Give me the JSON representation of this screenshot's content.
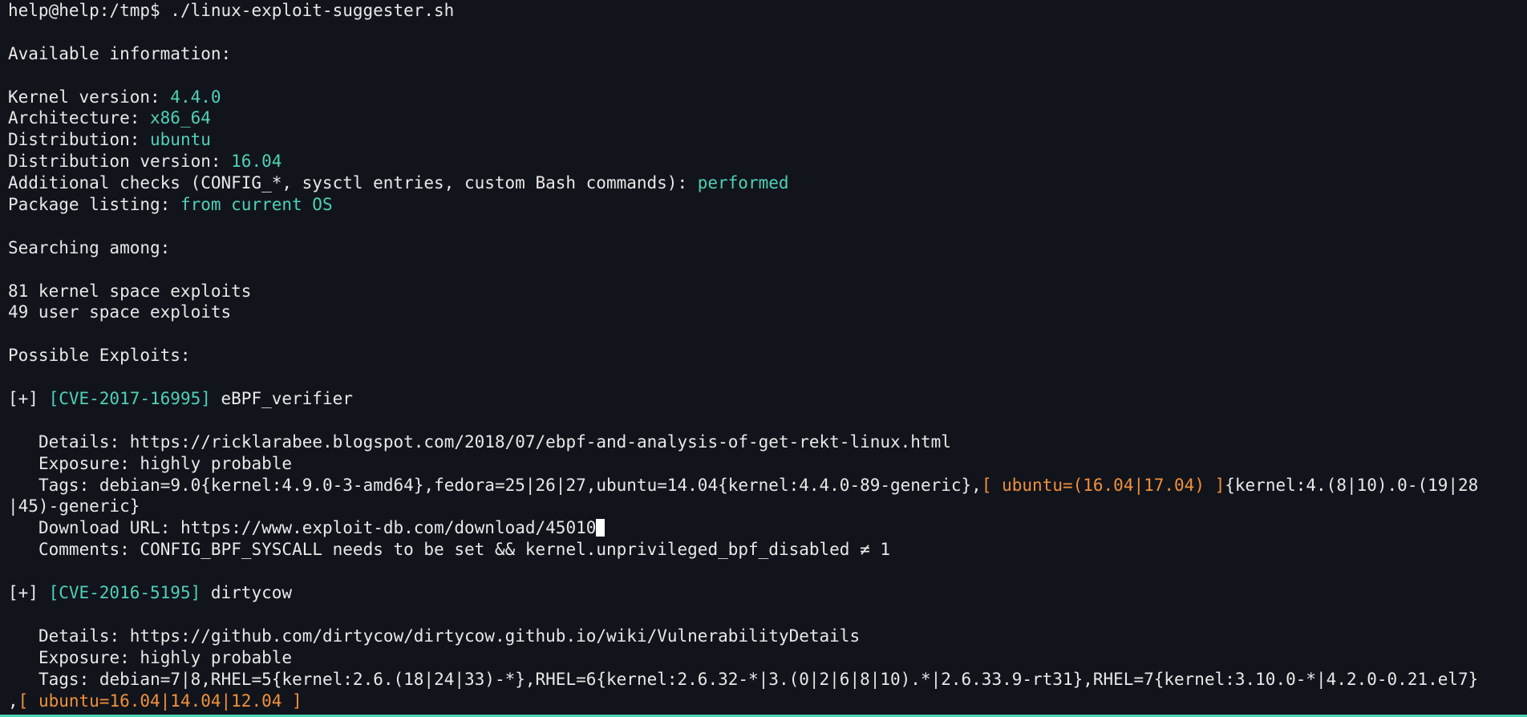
{
  "prompt": {
    "user_host": "help@help:/tmp$",
    "command": " ./linux-exploit-suggester.sh"
  },
  "available": {
    "heading": "Available information:",
    "kernel_label": "Kernel version: ",
    "kernel_value": "4.4.0",
    "arch_label": "Architecture: ",
    "arch_value": "x86_64",
    "dist_label": "Distribution: ",
    "dist_value": "ubuntu",
    "distver_label": "Distribution version: ",
    "distver_value": "16.04",
    "checks_label": "Additional checks (CONFIG_*, sysctl entries, custom Bash commands): ",
    "checks_value": "performed",
    "pkg_label": "Package listing: ",
    "pkg_value": "from current OS"
  },
  "searching": {
    "heading": "Searching among:",
    "kernel_count": "81 kernel space exploits",
    "user_count": "49 user space exploits"
  },
  "possible_heading": "Possible Exploits:",
  "exploit1": {
    "marker": "[+] ",
    "cve": "[CVE-2017-16995]",
    "name": " eBPF_verifier",
    "details": "Details: https://ricklarabee.blogspot.com/2018/07/ebpf-and-analysis-of-get-rekt-linux.html",
    "exposure": "Exposure: highly probable",
    "tags_pre": "Tags: debian=9.0{kernel:4.9.0-3-amd64},fedora=25|26|27,ubuntu=14.04{kernel:4.4.0-89-generic},",
    "tags_hl": "[ ubuntu=(16.04|17.04) ]",
    "tags_post": "{kernel:4.(8|10).0-(19|28",
    "tags_wrap": "|45)-generic}",
    "download": "Download URL: https://www.exploit-db.com/download/45010",
    "comments": "Comments: CONFIG_BPF_SYSCALL needs to be set && kernel.unprivileged_bpf_disabled ≠ 1"
  },
  "exploit2": {
    "marker": "[+] ",
    "cve": "[CVE-2016-5195]",
    "name": " dirtycow",
    "details": "Details: https://github.com/dirtycow/dirtycow.github.io/wiki/VulnerabilityDetails",
    "exposure": "Exposure: highly probable",
    "tags_pre": "Tags: debian=7|8,RHEL=5{kernel:2.6.(18|24|33)-*},RHEL=6{kernel:2.6.32-*|3.(0|2|6|8|10).*|2.6.33.9-rt31},RHEL=7{kernel:3.10.0-*|4.2.0-0.21.el7}",
    "tags_wrap_pre": ",",
    "tags_wrap_hl": "[ ubuntu=16.04|14.04|12.04 ]"
  },
  "colors": {
    "background": "#12141c",
    "text": "#e8e8e8",
    "accent_teal": "#4fd1b5",
    "accent_orange": "#f0913b"
  }
}
